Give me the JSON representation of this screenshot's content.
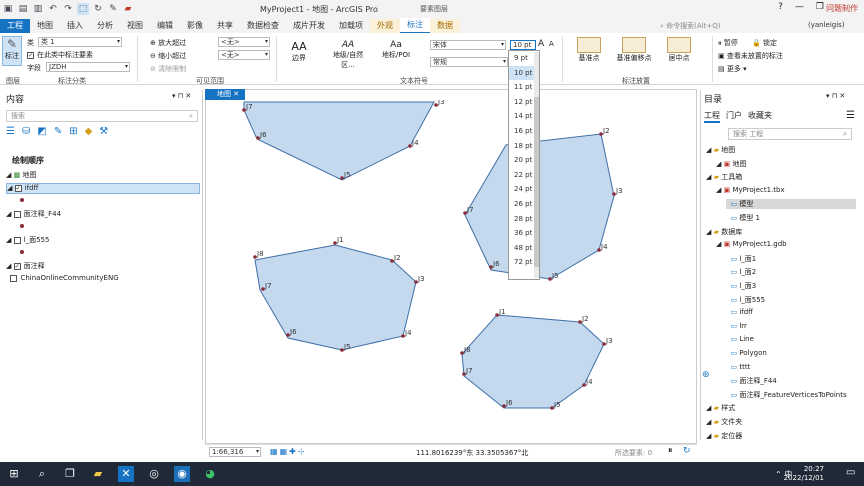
{
  "window": {
    "title": "MyProject1 - 地图 - ArcGIS Pro",
    "context_header": "要素图层",
    "watermark": "问题制作",
    "min": "—",
    "restore": "❐",
    "close": "✕",
    "help": "?"
  },
  "tabs": [
    "工程",
    "地图",
    "插入",
    "分析",
    "视图",
    "编辑",
    "影像",
    "共享",
    "数据检查",
    "成片开发",
    "加载项",
    "外观",
    "标注",
    "数据"
  ],
  "command_search": {
    "placeholder": "命令搜索(Alt+Q)"
  },
  "user": "(yanleigis)",
  "ribbon": {
    "label_btn": "标注",
    "class_label": "类",
    "class_value": "类 1",
    "in_class_label": "在此类中标注要素",
    "field_label": "字段",
    "field_value": "JZDH",
    "group_label_class": "标注分类",
    "zoom_in_limit": "放大超过",
    "zoom_out_limit": "缩小超过",
    "clear_limits": "清除限制",
    "none1": "<无>",
    "none2": "<无>",
    "group_visible_range": "可见范围",
    "style_border": "边界",
    "style_place": "地级/自然区...",
    "style_poi": "地标/POI",
    "font_name": "宋体",
    "font_size": "10 pt",
    "font_style": "常规",
    "group_text_symbol": "文本符号",
    "base_point": "基准点",
    "base_offset": "基准偏移点",
    "center_point": "居中点",
    "group_label_place": "标注放置",
    "pause": "暂停",
    "lock": "锁定",
    "view_unplaced": "查看未放置的标注",
    "more": "更多",
    "group_map": "图层"
  },
  "font_size_options": [
    "9 pt",
    "10 pt",
    "11 pt",
    "12 pt",
    "14 pt",
    "16 pt",
    "18 pt",
    "20 pt",
    "22 pt",
    "24 pt",
    "26 pt",
    "28 pt",
    "36 pt",
    "48 pt",
    "72 pt"
  ],
  "contents": {
    "title": "内容",
    "search_placeholder": "搜索",
    "draw_order": "绘制顺序",
    "map": "地图",
    "layers": [
      {
        "name": "ifdff",
        "checked": "✓",
        "selected": true
      },
      {
        "name": "面注释_F44",
        "checked": ""
      },
      {
        "name": "l_面555",
        "checked": ""
      },
      {
        "name": "面注释",
        "checked": "✓"
      },
      {
        "name": "ChinaOnlineCommunityENG",
        "checked": ""
      }
    ]
  },
  "map_tab": "地图",
  "map_labels": {
    "p1": [
      "J3",
      "J4",
      "J5",
      "J6",
      "J7"
    ],
    "p2": [
      "J1",
      "J2",
      "J3",
      "J4",
      "J5",
      "J6",
      "J7",
      "J8"
    ],
    "p3": [
      "J2",
      "J3",
      "J4",
      "J5",
      "J6",
      "J7"
    ],
    "p4": [
      "J1",
      "J2",
      "J3",
      "J4",
      "J5",
      "J6",
      "J7",
      "J8"
    ]
  },
  "status": {
    "scale": "1:66,316",
    "coords": "111.8016239°东 33.3505367°北",
    "selected": "所选要素: 0"
  },
  "catalog": {
    "title": "目录",
    "tabs": [
      "工程",
      "门户",
      "收藏夹"
    ],
    "search_placeholder": "搜索 工程",
    "items": [
      {
        "t": "地图",
        "lv": 1
      },
      {
        "t": "地图",
        "lv": 2
      },
      {
        "t": "工具箱",
        "lv": 1
      },
      {
        "t": "MyProject1.tbx",
        "lv": 2
      },
      {
        "t": "模型",
        "lv": 3,
        "sel": true
      },
      {
        "t": "模型 1",
        "lv": 3
      },
      {
        "t": "数据库",
        "lv": 1
      },
      {
        "t": "MyProject1.gdb",
        "lv": 2
      },
      {
        "t": "l_面1",
        "lv": 3
      },
      {
        "t": "l_面2",
        "lv": 3
      },
      {
        "t": "l_面3",
        "lv": 3
      },
      {
        "t": "l_面555",
        "lv": 3
      },
      {
        "t": "ifdff",
        "lv": 3
      },
      {
        "t": "lrr",
        "lv": 3
      },
      {
        "t": "Line",
        "lv": 3
      },
      {
        "t": "Polygon",
        "lv": 3
      },
      {
        "t": "tttt",
        "lv": 3
      },
      {
        "t": "面注释_F44",
        "lv": 3
      },
      {
        "t": "面注释_FeatureVerticesToPoints",
        "lv": 3
      },
      {
        "t": "样式",
        "lv": 1
      },
      {
        "t": "文件夹",
        "lv": 1
      },
      {
        "t": "定位器",
        "lv": 1
      }
    ]
  },
  "clock": {
    "time": "20:27",
    "date": "2022/12/01"
  },
  "tray": {
    "lang": "中"
  },
  "colors": {
    "accent": "#1673c4",
    "polygon_fill": "#c5d9ee",
    "polygon_stroke": "#3e6fa8"
  }
}
